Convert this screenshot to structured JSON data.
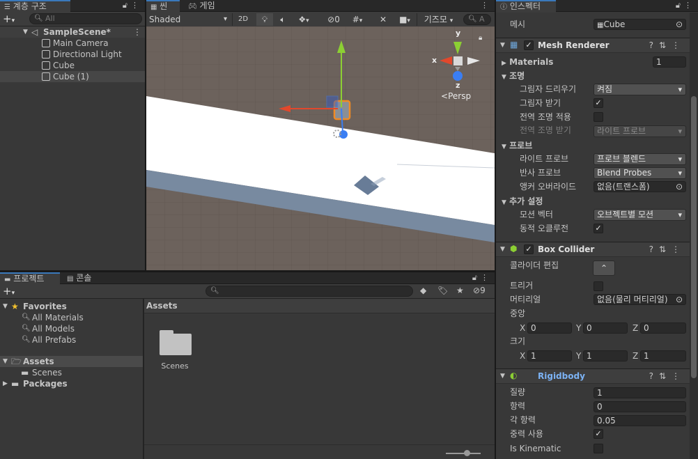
{
  "hierarchy": {
    "tab_label": "계층 구조",
    "search_placeholder": "All",
    "scene_name": "SampleScene*",
    "items": [
      "Main Camera",
      "Directional Light",
      "Cube",
      "Cube (1)"
    ]
  },
  "scene_view": {
    "tab_scene": "씬",
    "tab_game": "게임",
    "shading_mode": "Shaded",
    "mode_2d": "2D",
    "hidden_count": "0",
    "gizmos_label": "기즈모",
    "search_placeholder": "A",
    "persp_label": "Persp",
    "axis_x": "x",
    "axis_y": "y",
    "axis_z": "z"
  },
  "project": {
    "tab_project": "프로젝트",
    "tab_console": "콘솔",
    "hidden_count": "9",
    "favorites_label": "Favorites",
    "favorites": [
      "All Materials",
      "All Models",
      "All Prefabs"
    ],
    "assets_label": "Assets",
    "asset_children": [
      "Scenes"
    ],
    "packages_label": "Packages",
    "breadcrumb": "Assets",
    "grid_items": [
      "Scenes"
    ]
  },
  "inspector": {
    "tab_label": "인스펙터",
    "mesh_label": "메시",
    "mesh_value": "Cube",
    "mesh_renderer": {
      "title": "Mesh Renderer",
      "materials_label": "Materials",
      "materials_count": "1",
      "lighting_label": "조명",
      "cast_shadows_label": "그림자 드리우기",
      "cast_shadows_value": "켜짐",
      "receive_shadows_label": "그림자 받기",
      "contribute_gi_label": "전역 조명 적용",
      "receive_gi_label": "전역 조명 받기",
      "receive_gi_value": "라이트 프로브",
      "probes_label": "프로브",
      "light_probes_label": "라이트 프로브",
      "light_probes_value": "프로브 블렌드",
      "reflection_probes_label": "반사 프로브",
      "reflection_probes_value": "Blend Probes",
      "anchor_override_label": "앵커 오버라이드",
      "anchor_override_value": "없음(트랜스폼)",
      "additional_label": "추가 설정",
      "motion_vectors_label": "모션 벡터",
      "motion_vectors_value": "오브젝트별 모션",
      "dynamic_occlusion_label": "동적 오클루전"
    },
    "box_collider": {
      "title": "Box Collider",
      "edit_collider_label": "콜라이더 편집",
      "trigger_label": "트리거",
      "material_label": "머티리얼",
      "material_value": "없음(물리 머티리얼)",
      "center_label": "중앙",
      "center": {
        "x": "0",
        "y": "0",
        "z": "0"
      },
      "size_label": "크기",
      "size": {
        "x": "1",
        "y": "1",
        "z": "1"
      },
      "x_label": "X",
      "y_label": "Y",
      "z_label": "Z"
    },
    "rigidbody": {
      "title": "Rigidbody",
      "mass_label": "질량",
      "mass_value": "1",
      "drag_label": "항력",
      "drag_value": "0",
      "angular_drag_label": "각 항력",
      "angular_drag_value": "0.05",
      "use_gravity_label": "중력 사용",
      "is_kinematic_label": "Is Kinematic"
    }
  },
  "colors": {
    "accent_blue": "#3a79bb",
    "rigidbody_title": "#7cb3f5",
    "gizmo_x": "#e2482c",
    "gizmo_y": "#8ccf33",
    "gizmo_z": "#3a7ef3",
    "selection_orange": "#f08a24"
  }
}
